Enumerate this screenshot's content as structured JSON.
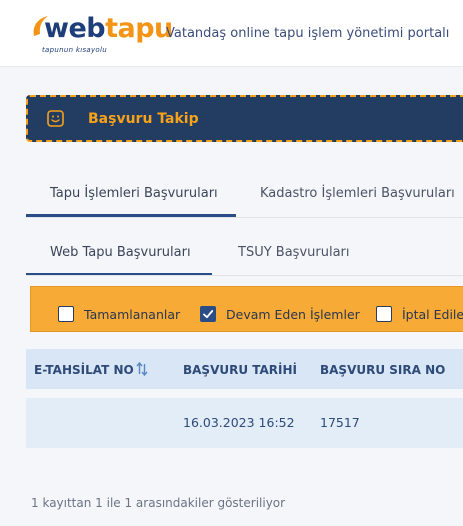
{
  "header": {
    "logo": {
      "primary": "web",
      "accent": "tapu",
      "subtitle": "tapunun kısayolu"
    },
    "tagline": "Vatandaş online tapu işlem yönetimi portalı"
  },
  "banner": {
    "title": "Başvuru Takip",
    "icon": "smile-icon"
  },
  "tabs_primary": [
    {
      "label": "Tapu İşlemleri Başvuruları",
      "active": true
    },
    {
      "label": "Kadastro İşlemleri Başvuruları",
      "active": false
    }
  ],
  "tabs_secondary": [
    {
      "label": "Web Tapu Başvuruları",
      "active": true
    },
    {
      "label": "TSUY Başvuruları",
      "active": false
    }
  ],
  "filters": [
    {
      "label": "Tamamlananlar",
      "checked": false
    },
    {
      "label": "Devam Eden İşlemler",
      "checked": true
    },
    {
      "label": "İptal Edilen",
      "checked": false
    }
  ],
  "table": {
    "columns": [
      "E-TAHSİLAT NO",
      "BAŞVURU TARİHİ",
      "BAŞVURU SIRA NO"
    ],
    "rows": [
      {
        "etahsilat_no": "",
        "basvuru_tarihi": "16.03.2023 16:52",
        "sira_no": "17517"
      }
    ]
  },
  "footer": {
    "info": "1 kayıttan 1 ile 1 arasındakiler gösteriliyor"
  },
  "colors": {
    "brand_navy": "#1e3e7a",
    "brand_orange": "#f39416",
    "banner_bg": "#233c62",
    "filter_bg": "#f7ab36"
  }
}
